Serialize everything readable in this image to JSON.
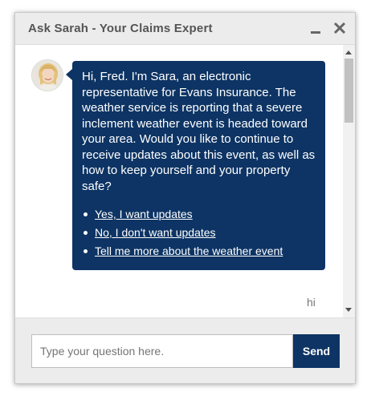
{
  "window": {
    "title": "Ask Sarah - Your Claims Expert"
  },
  "title_buttons": {
    "minimize_icon": "minimize-icon",
    "close_icon": "close-icon"
  },
  "bot_message": {
    "text": "Hi, Fred. I'm Sara, an electronic representative for Evans Insurance. The weather service is reporting that a severe inclement weather event is headed toward your area. Would you like to continue to receive updates about this event, as well as how to keep yourself and your property safe?",
    "options": [
      {
        "label": "Yes, I want updates"
      },
      {
        "label": "No, I don't want updates"
      },
      {
        "label": "Tell me more about the weather event"
      }
    ]
  },
  "user_message": {
    "text": "hi"
  },
  "composer": {
    "placeholder": "Type your question here.",
    "send_label": "Send"
  },
  "colors": {
    "accent": "#0d3464",
    "title_bar": "#ececec"
  }
}
